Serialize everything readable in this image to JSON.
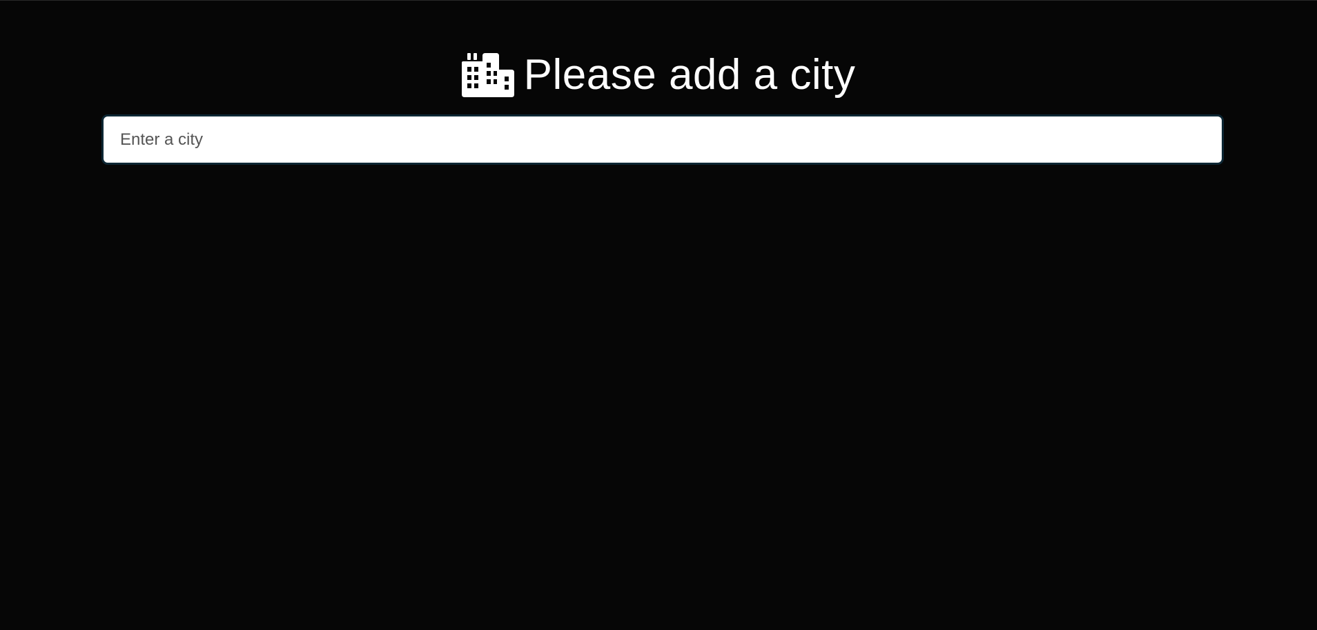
{
  "header": {
    "icon": "city-buildings-icon",
    "title": "Please add a city"
  },
  "search": {
    "placeholder": "Enter a city",
    "value": ""
  },
  "colors": {
    "background": "#060606",
    "title_text": "#ffffff",
    "input_background": "#ffffff",
    "input_border": "#0d2734",
    "placeholder_text": "#555555"
  }
}
